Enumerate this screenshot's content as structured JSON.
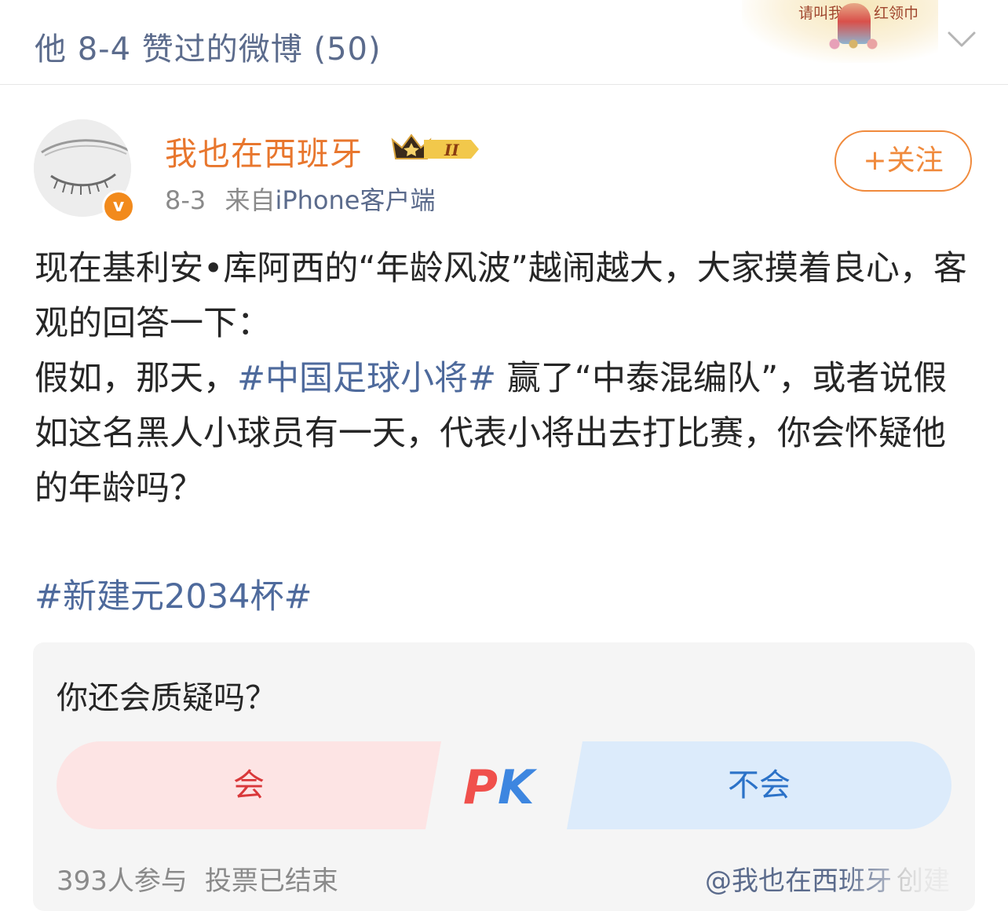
{
  "header": {
    "title": "他 8-4 赞过的微博 (50)",
    "banner_text_left": "请叫我",
    "banner_text_right": "红领巾"
  },
  "post": {
    "username": "我也在西班牙",
    "member_level": "II",
    "date": "8-3",
    "source_prefix": "来自",
    "source": "iPhone客户端",
    "follow_label": "+关注",
    "verified_badge": "v",
    "content_part1": "现在基利安•库阿西的“年龄风波”越闹越大，大家摸着良心，客观的回答一下：",
    "content_part2": "假如，那天，",
    "hashtag1": "#中国足球小将#",
    "content_part3": " 赢了“中泰混编队”，或者说假如这名黑人小球员有一天，代表小将出去打比赛，你会怀疑他的年龄吗？",
    "hashtag2": "#新建元2034杯#"
  },
  "poll": {
    "question": "你还会质疑吗？",
    "option_a": "会",
    "option_b": "不会",
    "vs_p": "P",
    "vs_k": "K",
    "participants": "393人参与",
    "status": "投票已结束",
    "creator": "@我也在西班牙",
    "creator_suffix": "创建"
  },
  "colors": {
    "link": "#4e6a9c",
    "username": "#e8762d",
    "follow": "#f08a3c",
    "option_a_bg": "#fde4e4",
    "option_b_bg": "#dcebfb"
  }
}
